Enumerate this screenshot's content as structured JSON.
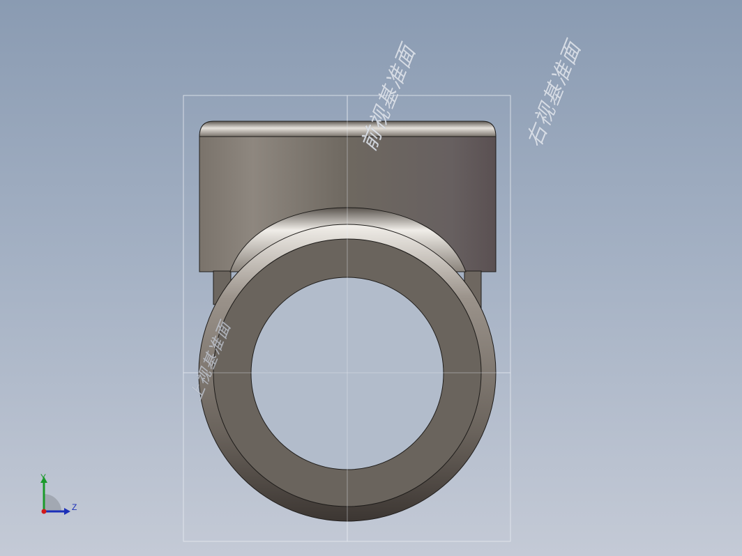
{
  "viewport": {
    "background_top": "#8a9bb2",
    "background_bottom": "#c4cad6",
    "model_color": "#6a645d"
  },
  "reference_planes": {
    "front_plane_label": "前视基准面",
    "right_plane_label": "右视基准面",
    "top_plane_label": "上视基准面"
  },
  "triad": {
    "y_axis_label": "Y",
    "z_axis_label": "Z",
    "y_axis_color": "#1a9a2a",
    "z_axis_color": "#1b2fb8",
    "origin_color": "#d21a1a"
  }
}
